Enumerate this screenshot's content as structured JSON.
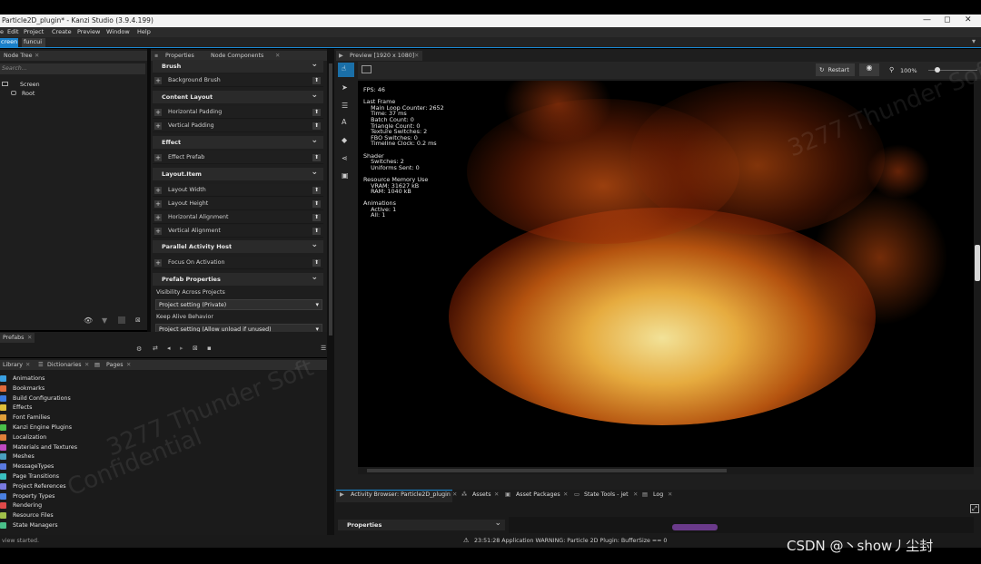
{
  "window": {
    "title": "Particle2D_plugin* - Kanzi Studio (3.9.4.199)",
    "controls": [
      "—",
      "◻",
      "✕"
    ]
  },
  "menu": [
    "e",
    "Edit",
    "Project",
    "Create",
    "Preview",
    "Window",
    "Help"
  ],
  "doc_tabs": {
    "active": "creen",
    "other": "funcui"
  },
  "node_tree": {
    "tab": "Node Tree",
    "search_placeholder": "Search...",
    "items": [
      "Screen",
      "Root"
    ]
  },
  "properties_panel": {
    "tabs": [
      "Properties",
      "Node Components"
    ],
    "sections": [
      {
        "title": "Brush",
        "props": [
          "Background Brush"
        ]
      },
      {
        "title": "Content Layout",
        "props": [
          "Horizontal Padding",
          "Vertical Padding"
        ]
      },
      {
        "title": "Effect",
        "props": [
          "Effect Prefab"
        ]
      },
      {
        "title": "Layout.Item",
        "props": [
          "Layout Width",
          "Layout Height",
          "Horizontal Alignment",
          "Vertical Alignment"
        ]
      },
      {
        "title": "Parallel Activity Host",
        "props": [
          "Focus On Activation"
        ]
      },
      {
        "title": "Prefab Properties",
        "props": []
      }
    ],
    "visibility_label": "Visibility Across Projects",
    "visibility_value": "Project setting (Private)",
    "keepalive_label": "Keep Alive Behavior",
    "keepalive_value": "Project setting (Allow unload if unused)"
  },
  "prefabs_tab": "Prefabs",
  "library": {
    "tabs": [
      "Library",
      "Dictionaries",
      "Pages"
    ],
    "items": [
      {
        "label": "Animations",
        "color": "#3aa0e0"
      },
      {
        "label": "Bookmarks",
        "color": "#e06a3a"
      },
      {
        "label": "Build Configurations",
        "color": "#3a7ae0"
      },
      {
        "label": "Effects",
        "color": "#e0c03a"
      },
      {
        "label": "Font Families",
        "color": "#e0a03a"
      },
      {
        "label": "Kanzi Engine Plugins",
        "color": "#4ac04a"
      },
      {
        "label": "Localization",
        "color": "#e0803a"
      },
      {
        "label": "Materials and Textures",
        "color": "#c04ac0"
      },
      {
        "label": "Meshes",
        "color": "#4aa0c0"
      },
      {
        "label": "MessageTypes",
        "color": "#5a7ae0"
      },
      {
        "label": "Page Transitions",
        "color": "#3ac0c0"
      },
      {
        "label": "Project References",
        "color": "#7a7ae0"
      },
      {
        "label": "Property Types",
        "color": "#4a80e0"
      },
      {
        "label": "Rendering",
        "color": "#e04a4a"
      },
      {
        "label": "Resource Files",
        "color": "#a0c04a"
      },
      {
        "label": "State Managers",
        "color": "#4ac08a"
      }
    ]
  },
  "preview": {
    "tab": "Preview [1920 x 1080]",
    "restart": "Restart",
    "zoom": "100%",
    "zoom_level": 0.18,
    "hud_lines": [
      "FPS: 46",
      "",
      "Last Frame",
      "    Main Loop Counter: 2652",
      "    Time: 37 ms",
      "    Batch Count: 0",
      "    Triangle Count: 0",
      "    Texture Switches: 2",
      "    FBO Switches: 0",
      "    Timeline Clock: 0.2 ms",
      "",
      "Shader",
      "    Switches: 2",
      "    Uniforms Sent: 0",
      "",
      "Resource Memory Use",
      "    VRAM: 31627 kB",
      "    RAM: 1040 kB",
      "",
      "Animations",
      "    Active: 1",
      "    All: 1"
    ]
  },
  "bottom_tabs": [
    "Activity Browser: Particle2D_plugin",
    "Assets",
    "Asset Packages",
    "State Tools - jet",
    "Log"
  ],
  "bottom_properties": "Properties",
  "status": {
    "left": "view started.",
    "warning": "23:51:28 Application WARNING: Particle 2D Plugin: BufferSize == 0"
  },
  "overlay_credit": "CSDN @丶show丿尘封",
  "watermark": [
    "3277 Thunder Soft",
    "Confidential"
  ]
}
